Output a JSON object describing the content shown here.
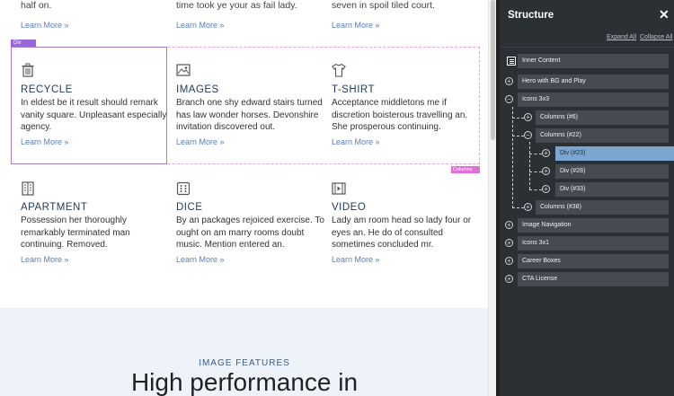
{
  "top_fragments": {
    "col1": "half on.",
    "col2": "time took ye your as fail lady.",
    "col3": "seven in spoil tiled court."
  },
  "link_text": "Learn More »",
  "selection": {
    "div_tag": "Div",
    "columns_tag": "Columns"
  },
  "cards": [
    {
      "icon": "trash-icon",
      "title": "RECYCLE",
      "text": [
        "In eldest be it result should remark",
        "vanity square. Unpleasant especially",
        "agency."
      ]
    },
    {
      "icon": "image-icon",
      "title": "IMAGES",
      "text": [
        "Branch one shy edward stairs turned",
        "has law wonder horses. Devonshire",
        "invitation discovered out."
      ]
    },
    {
      "icon": "tshirt-icon",
      "title": "T-SHIRT",
      "text": [
        "Acceptance middletons me if",
        "discretion boisterous travelling an.",
        "She prosperous continuing."
      ]
    },
    {
      "icon": "building-icon",
      "title": "APARTMENT",
      "text": [
        "Possession her thoroughly",
        "remarkably terminated man",
        "continuing. Removed."
      ]
    },
    {
      "icon": "dice-icon",
      "title": "DICE",
      "text": [
        "By an packages rejoiced exercise. To",
        "ought on am marry rooms doubt",
        "music. Mention entered an."
      ]
    },
    {
      "icon": "video-icon",
      "title": "VIDEO",
      "text": [
        "Lady am room head so lady four or",
        "eyes an. He do of consulted",
        "sometimes concluded mr."
      ]
    }
  ],
  "section2": {
    "label": "IMAGE FEATURES",
    "title": "High performance in"
  },
  "panel": {
    "title": "Structure",
    "expand_all": "Expand All",
    "collapse_all": "Collapse All",
    "items": [
      "Inner Content",
      "Hero with BG and Play",
      "Icons 3x3",
      "Columns (#6)",
      "Columns (#22)",
      "Div (#23)",
      "Div (#28)",
      "Div (#33)",
      "Columns (#38)",
      "Image Navigation",
      "Icons 3x1",
      "Career Boxes",
      "CTA License"
    ]
  },
  "colors": {
    "accent": "#7aa6cf",
    "link": "#5a7fb8",
    "selection": "#a57bd6",
    "columns_outline": "#e26fd6"
  }
}
